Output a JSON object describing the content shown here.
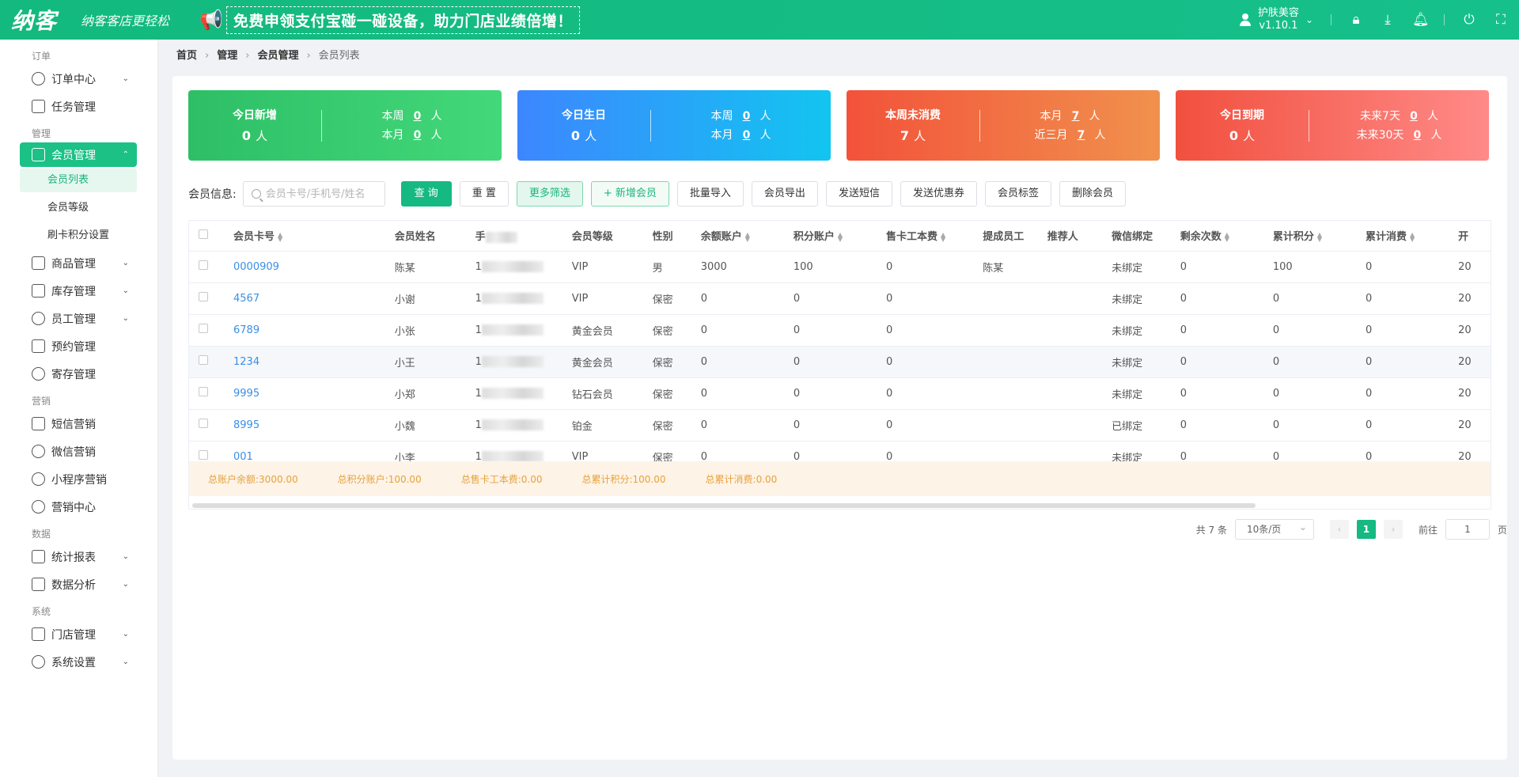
{
  "header": {
    "logo": "纳客",
    "slogan": "纳客客店更轻松",
    "promo": "免费申领支付宝碰一碰设备，助力门店业绩倍增！",
    "user_name": "护肤美容",
    "version": "v1.10.1",
    "accent": "#13b97e"
  },
  "sidebar": {
    "sections": [
      {
        "title": "订单",
        "items": [
          {
            "label": "订单中心",
            "icon": "globe-icon",
            "chev": true
          },
          {
            "label": "任务管理",
            "icon": "task-icon",
            "chev": false
          }
        ]
      },
      {
        "title": "管理",
        "items": [
          {
            "label": "会员管理",
            "icon": "crown-icon",
            "chev": true,
            "active": true
          }
        ]
      },
      {
        "title": "营销",
        "items": [
          {
            "label": "短信营销",
            "icon": "mail-icon"
          },
          {
            "label": "微信营销",
            "icon": "wechat-icon"
          },
          {
            "label": "小程序营销",
            "icon": "miniapp-icon"
          },
          {
            "label": "营销中心",
            "icon": "target-icon"
          }
        ]
      },
      {
        "title": "数据",
        "items": [
          {
            "label": "统计报表",
            "icon": "bar-chart-icon",
            "chev": true
          },
          {
            "label": "数据分析",
            "icon": "monitor-icon",
            "chev": true
          }
        ]
      },
      {
        "title": "系统",
        "items": [
          {
            "label": "门店管理",
            "icon": "store-icon",
            "chev": true
          },
          {
            "label": "系统设置",
            "icon": "gear-icon",
            "chev": true
          }
        ]
      }
    ],
    "member_sub": [
      "会员列表",
      "会员等级",
      "刷卡积分设置"
    ],
    "manage_more": [
      {
        "label": "商品管理",
        "icon": "goods-icon",
        "chev": true
      },
      {
        "label": "库存管理",
        "icon": "stock-icon",
        "chev": true
      },
      {
        "label": "员工管理",
        "icon": "staff-icon",
        "chev": true
      },
      {
        "label": "预约管理",
        "icon": "calendar-icon",
        "chev": false
      },
      {
        "label": "寄存管理",
        "icon": "deposit-icon",
        "chev": false
      }
    ]
  },
  "breadcrumb": [
    "首页",
    "管理",
    "会员管理",
    "会员列表"
  ],
  "cards": [
    {
      "title": "今日新增",
      "num": "0",
      "unit": "人",
      "r1_label": "本周",
      "r1_val": "0",
      "r2_label": "本月",
      "r2_val": "0",
      "r_unit": "人"
    },
    {
      "title": "今日生日",
      "num": "0",
      "unit": "人",
      "r1_label": "本周",
      "r1_val": "0",
      "r2_label": "本月",
      "r2_val": "0",
      "r_unit": "人"
    },
    {
      "title": "本周未消费",
      "num": "7",
      "unit": "人",
      "r1_label": "本月",
      "r1_val": "7",
      "r2_label": "近三月",
      "r2_val": "7",
      "r_unit": "人"
    },
    {
      "title": "今日到期",
      "num": "0",
      "unit": "人",
      "r1_label": "未来7天",
      "r1_val": "0",
      "r2_label": "未来30天",
      "r2_val": "0",
      "r_unit": "人"
    }
  ],
  "toolbar": {
    "label": "会员信息:",
    "placeholder": "会员卡号/手机号/姓名",
    "query": "查 询",
    "reset": "重 置",
    "more": "更多筛选",
    "add": "+ 新增会员",
    "import": "批量导入",
    "export": "会员导出",
    "sms": "发送短信",
    "coupon": "发送优惠券",
    "tag": "会员标签",
    "delete": "删除会员"
  },
  "table": {
    "headers": [
      "会员卡号",
      "会员姓名",
      "手",
      "会员等级",
      "性别",
      "余额账户",
      "积分账户",
      "售卡工本费",
      "提成员工",
      "推荐人",
      "微信绑定",
      "剩余次数",
      "累计积分",
      "累计消费",
      "开"
    ],
    "rows": [
      [
        "0000909",
        "陈某",
        "1",
        "VIP",
        "男",
        "3000",
        "100",
        "0",
        "陈某",
        "",
        "未绑定",
        "0",
        "100",
        "0",
        "20"
      ],
      [
        "4567",
        "小谢",
        "1",
        "VIP",
        "保密",
        "0",
        "0",
        "0",
        "",
        "",
        "未绑定",
        "0",
        "0",
        "0",
        "20"
      ],
      [
        "6789",
        "小张",
        "1",
        "黄金会员",
        "保密",
        "0",
        "0",
        "0",
        "",
        "",
        "未绑定",
        "0",
        "0",
        "0",
        "20"
      ],
      [
        "1234",
        "小王",
        "1",
        "黄金会员",
        "保密",
        "0",
        "0",
        "0",
        "",
        "",
        "未绑定",
        "0",
        "0",
        "0",
        "20"
      ],
      [
        "9995",
        "小郑",
        "1",
        "钻石会员",
        "保密",
        "0",
        "0",
        "0",
        "",
        "",
        "未绑定",
        "0",
        "0",
        "0",
        "20"
      ],
      [
        "8995",
        "小魏",
        "1",
        "铂金",
        "保密",
        "0",
        "0",
        "0",
        "",
        "",
        "已绑定",
        "0",
        "0",
        "0",
        "20"
      ],
      [
        "001",
        "小李",
        "1",
        "VIP",
        "保密",
        "0",
        "0",
        "0",
        "",
        "",
        "未绑定",
        "0",
        "0",
        "0",
        "20"
      ]
    ],
    "summary": [
      "总账户余额:3000.00",
      "总积分账户:100.00",
      "总售卡工本费:0.00",
      "总累计积分:100.00",
      "总累计消费:0.00"
    ]
  },
  "pager": {
    "total": "共 7 条",
    "size": "10条/页",
    "current": "1",
    "goto_label": "前往",
    "goto_value": "1",
    "page_unit": "页"
  }
}
